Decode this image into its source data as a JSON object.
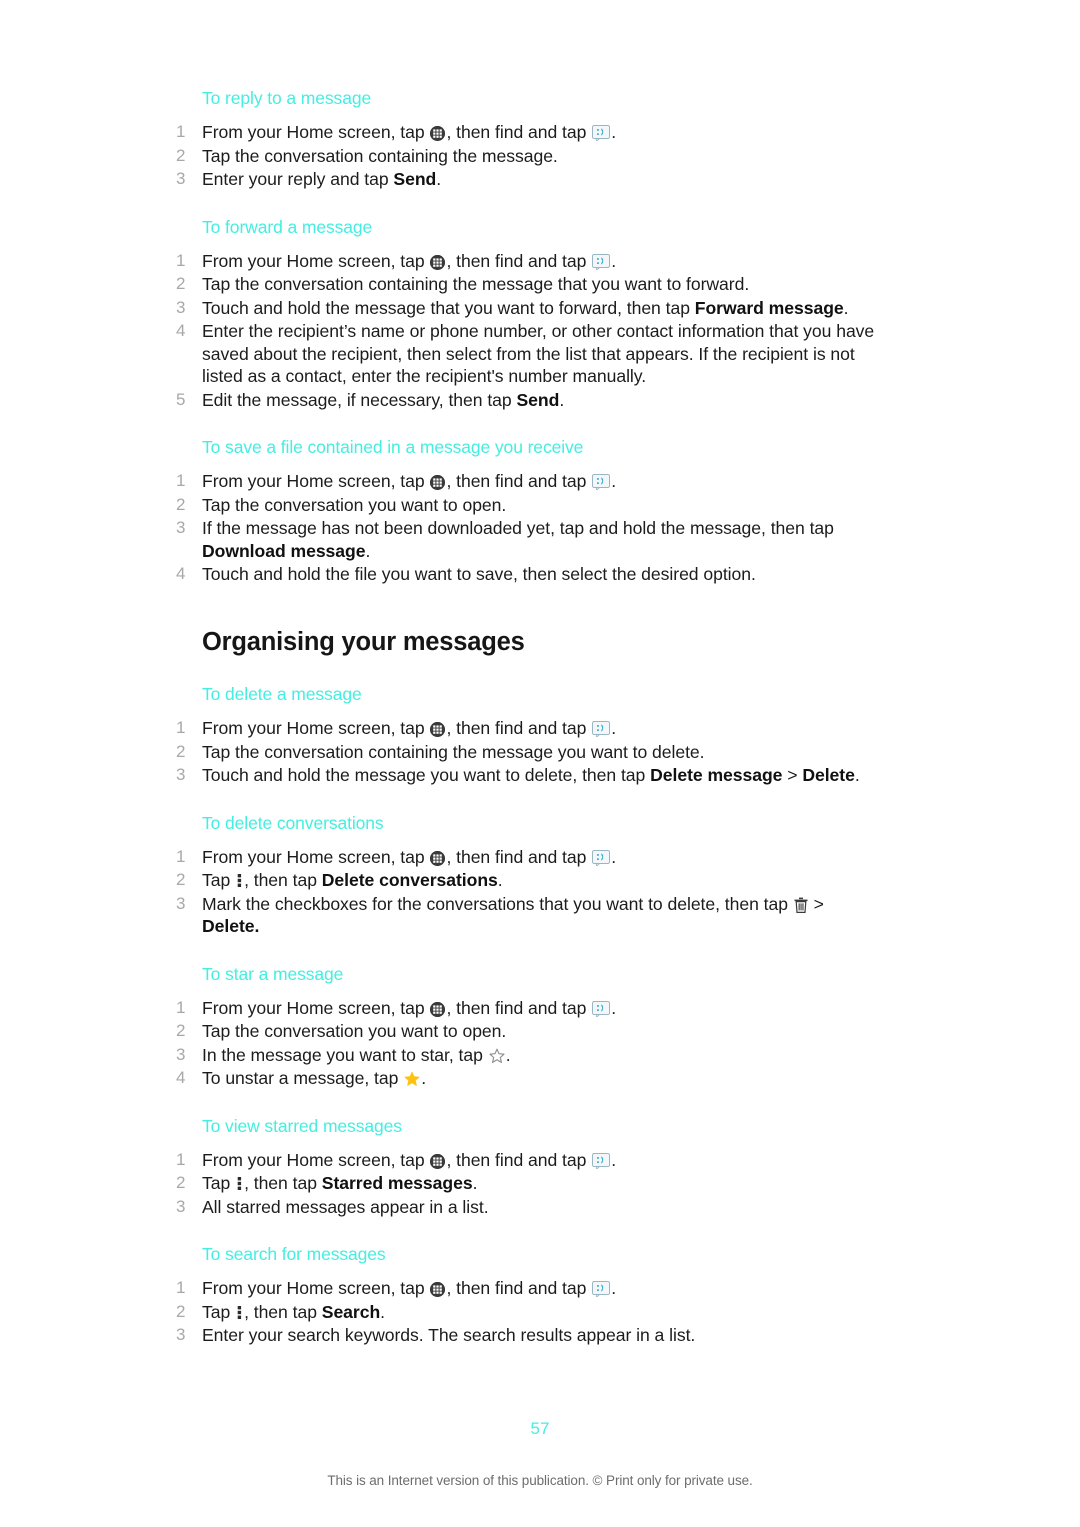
{
  "document": {
    "page_number": "57",
    "footer_note": "This is an Internet version of this publication. © Print only for private use.",
    "accent_color": "#45EEE0",
    "number_color": "#a8a8a8"
  },
  "icons": {
    "app_drawer": "app-drawer-icon",
    "messaging": "messaging-icon",
    "overflow_menu": "overflow-menu-icon",
    "trash": "trash-icon",
    "star_outline": "star-outline-icon",
    "star_filled": "star-filled-icon"
  },
  "sections": {
    "reply": {
      "heading": "To reply to a message",
      "steps": {
        "s1a": "From your Home screen, tap ",
        "s1b": ", then find and tap ",
        "s1c": ".",
        "s2": "Tap the conversation containing the message.",
        "s3a": "Enter your reply and tap ",
        "s3b": "Send",
        "s3c": "."
      }
    },
    "forward": {
      "heading": "To forward a message",
      "steps": {
        "s1a": "From your Home screen, tap ",
        "s1b": ", then find and tap ",
        "s1c": ".",
        "s2": "Tap the conversation containing the message that you want to forward.",
        "s3a": "Touch and hold the message that you want to forward, then tap ",
        "s3b": "Forward message",
        "s3c": ".",
        "s4": "Enter the recipient’s name or phone number, or other contact information that you have saved about the recipient, then select from the list that appears. If the recipient is not listed as a contact, enter the recipient's number manually.",
        "s5a": "Edit the message, if necessary, then tap ",
        "s5b": "Send",
        "s5c": "."
      }
    },
    "save_file": {
      "heading": "To save a file contained in a message you receive",
      "steps": {
        "s1a": "From your Home screen, tap ",
        "s1b": ", then find and tap ",
        "s1c": ".",
        "s2": "Tap the conversation you want to open.",
        "s3a": "If the message has not been downloaded yet, tap and hold the message, then tap ",
        "s3b": "Download message",
        "s3c": ".",
        "s4": "Touch and hold the file you want to save, then select the desired option."
      }
    },
    "organising": {
      "heading": "Organising your messages"
    },
    "delete_message": {
      "heading": "To delete a message",
      "steps": {
        "s1a": "From your Home screen, tap ",
        "s1b": ", then find and tap ",
        "s1c": ".",
        "s2": "Tap the conversation containing the message you want to delete.",
        "s3a": "Touch and hold the message you want to delete, then tap ",
        "s3b": "Delete message",
        "s3c": " > ",
        "s3d": "Delete",
        "s3e": "."
      }
    },
    "delete_conversations": {
      "heading": "To delete conversations",
      "steps": {
        "s1a": "From your Home screen, tap ",
        "s1b": ", then find and tap ",
        "s1c": ".",
        "s2a": "Tap ",
        "s2b": ", then tap ",
        "s2c": "Delete conversations",
        "s2d": ".",
        "s3a": "Mark the checkboxes for the conversations that you want to delete, then tap ",
        "s3b": " > ",
        "s3c": "Delete."
      }
    },
    "star_message": {
      "heading": "To star a message",
      "steps": {
        "s1a": "From your Home screen, tap ",
        "s1b": ", then find and tap ",
        "s1c": ".",
        "s2": "Tap the conversation you want to open.",
        "s3a": "In the message you want to star, tap ",
        "s3b": ".",
        "s4a": "To unstar a message, tap ",
        "s4b": "."
      }
    },
    "view_starred": {
      "heading": "To view starred messages",
      "steps": {
        "s1a": "From your Home screen, tap ",
        "s1b": ", then find and tap ",
        "s1c": ".",
        "s2a": "Tap ",
        "s2b": ", then tap ",
        "s2c": "Starred messages",
        "s2d": ".",
        "s3": "All starred messages appear in a list."
      }
    },
    "search": {
      "heading": "To search for messages",
      "steps": {
        "s1a": "From your Home screen, tap ",
        "s1b": ", then find and tap ",
        "s1c": ".",
        "s2a": "Tap ",
        "s2b": ", then tap ",
        "s2c": "Search",
        "s2d": ".",
        "s3": "Enter your search keywords. The search results appear in a list."
      }
    }
  }
}
